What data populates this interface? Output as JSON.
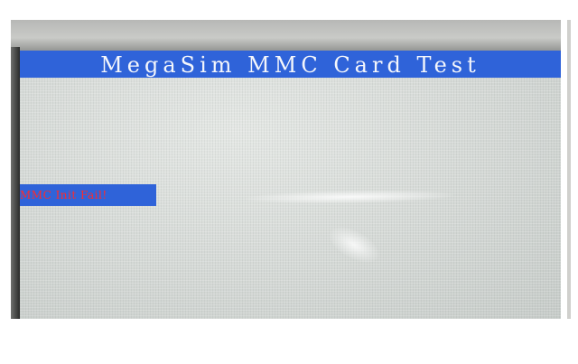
{
  "screen": {
    "title": "MegaSim MMC Card Test",
    "status_message": "MMC Init Fail!"
  },
  "colors": {
    "title_bar": "#2f63d9",
    "title_text": "#f4f6fb",
    "status_text": "#ff2a2a",
    "screen_background": "#d7dbd8"
  }
}
